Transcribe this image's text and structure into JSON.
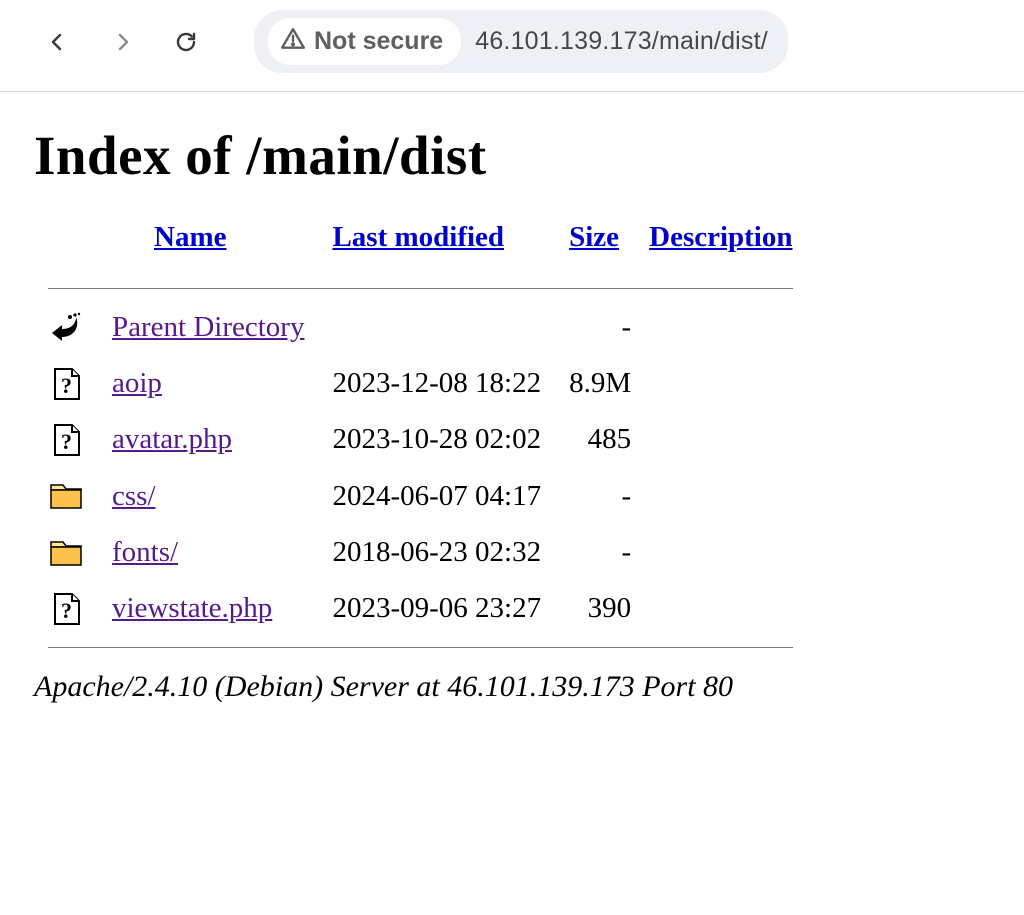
{
  "browser": {
    "not_secure_label": "Not secure",
    "url": "46.101.139.173/main/dist/"
  },
  "page": {
    "title": "Index of /main/dist",
    "columns": {
      "name": "Name",
      "modified": "Last modified",
      "size": "Size",
      "description": "Description"
    },
    "server_line": "Apache/2.4.10 (Debian) Server at 46.101.139.173 Port 80"
  },
  "entries": [
    {
      "icon": "back",
      "name": "Parent Directory",
      "modified": "",
      "size": "-"
    },
    {
      "icon": "unknown",
      "name": "aoip",
      "modified": "2023-12-08 18:22",
      "size": "8.9M"
    },
    {
      "icon": "unknown",
      "name": "avatar.php",
      "modified": "2023-10-28 02:02",
      "size": "485"
    },
    {
      "icon": "folder",
      "name": "css/",
      "modified": "2024-06-07 04:17",
      "size": "-"
    },
    {
      "icon": "folder",
      "name": "fonts/",
      "modified": "2018-06-23 02:32",
      "size": "-"
    },
    {
      "icon": "unknown",
      "name": "viewstate.php",
      "modified": "2023-09-06 23:27",
      "size": "390"
    }
  ]
}
